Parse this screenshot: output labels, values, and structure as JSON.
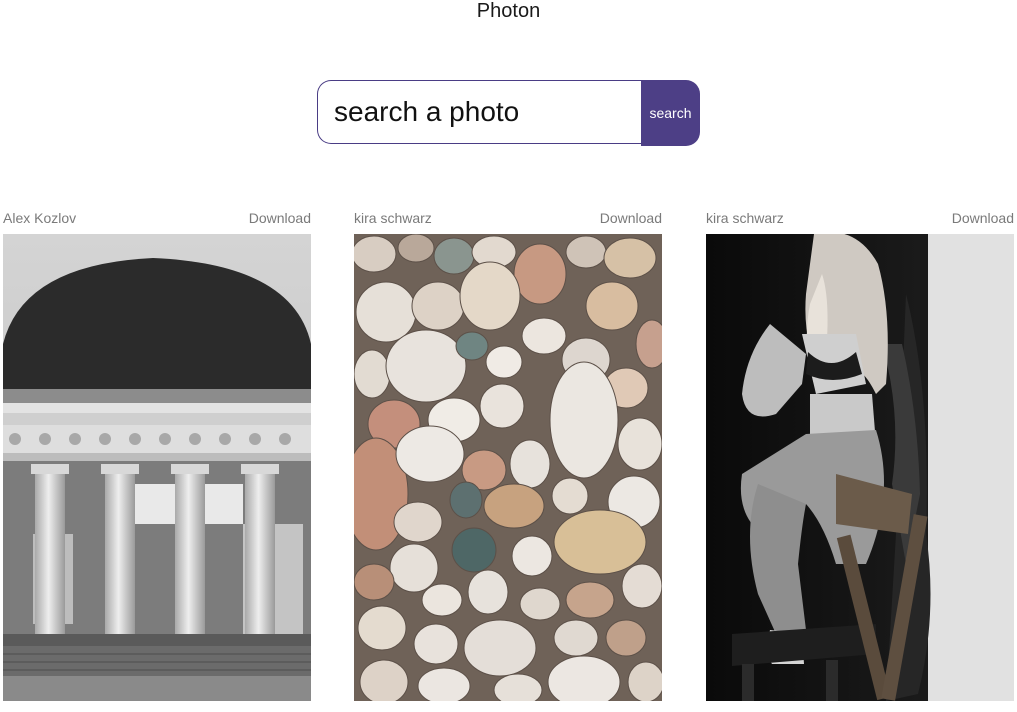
{
  "app": {
    "title": "Photon"
  },
  "search": {
    "placeholder": "search a photo",
    "button_label": "search"
  },
  "colors": {
    "accent": "#4d3f86",
    "muted_text": "#7a7a7a"
  },
  "photos": [
    {
      "author": "Alex Kozlov",
      "download_label": "Download",
      "subject": "photo-classical-colonnade"
    },
    {
      "author": "kira schwarz",
      "download_label": "Download",
      "subject": "photo-pebbles"
    },
    {
      "author": "kira schwarz",
      "download_label": "Download",
      "subject": "photo-woman-on-chair"
    }
  ]
}
